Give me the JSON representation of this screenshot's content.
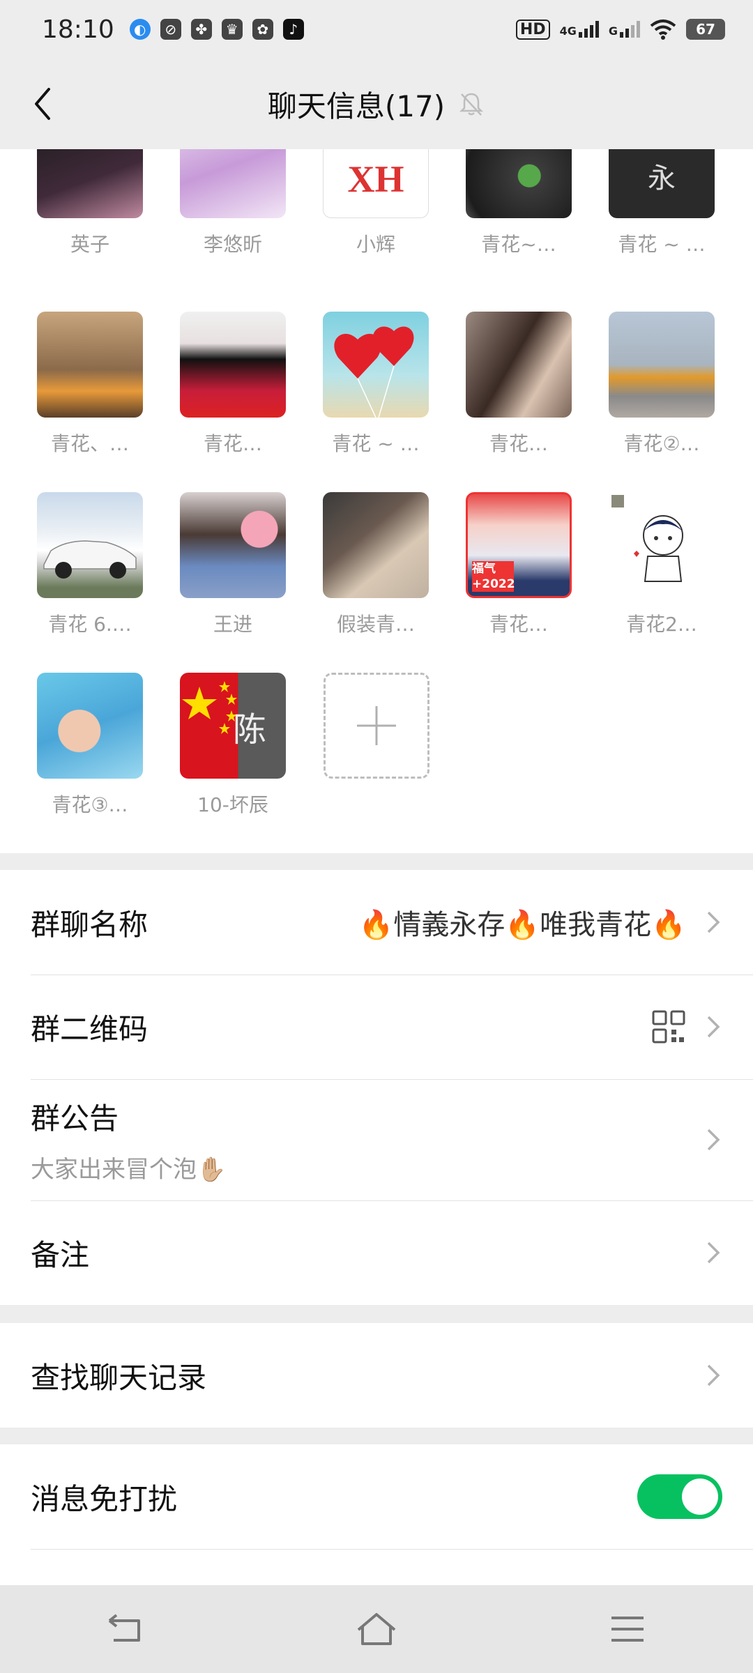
{
  "status_bar": {
    "time": "18:10",
    "battery": "67",
    "hd_label": "HD",
    "net1": "4G",
    "net2": "G"
  },
  "header": {
    "title": "聊天信息(17)"
  },
  "members": [
    {
      "name": "英子"
    },
    {
      "name": "李悠昕"
    },
    {
      "name": "小辉",
      "avatar_text": "XH"
    },
    {
      "name": "青花~…"
    },
    {
      "name": "青花 ~ …",
      "avatar_text": "永"
    },
    {
      "name": "青花、…"
    },
    {
      "name": "青花…"
    },
    {
      "name": "青花 ~ …"
    },
    {
      "name": "青花…"
    },
    {
      "name": "青花②…"
    },
    {
      "name": "青花 6.…"
    },
    {
      "name": "王进"
    },
    {
      "name": "假装青…"
    },
    {
      "name": "青花…",
      "avatar_text": "福气 +2022"
    },
    {
      "name": "青花2…"
    },
    {
      "name": "青花③…"
    },
    {
      "name": "10-坏辰",
      "avatar_text": "陈"
    }
  ],
  "settings": {
    "group_name_label": "群聊名称",
    "group_name_value": "🔥情義永存🔥唯我青花🔥",
    "qr_label": "群二维码",
    "notice_label": "群公告",
    "notice_value": "大家出来冒个泡✋🏼",
    "remark_label": "备注",
    "search_label": "查找聊天记录",
    "mute_label": "消息免打扰",
    "mute_on": true
  },
  "colors": {
    "accent_green": "#07c160",
    "background": "#ededed"
  }
}
